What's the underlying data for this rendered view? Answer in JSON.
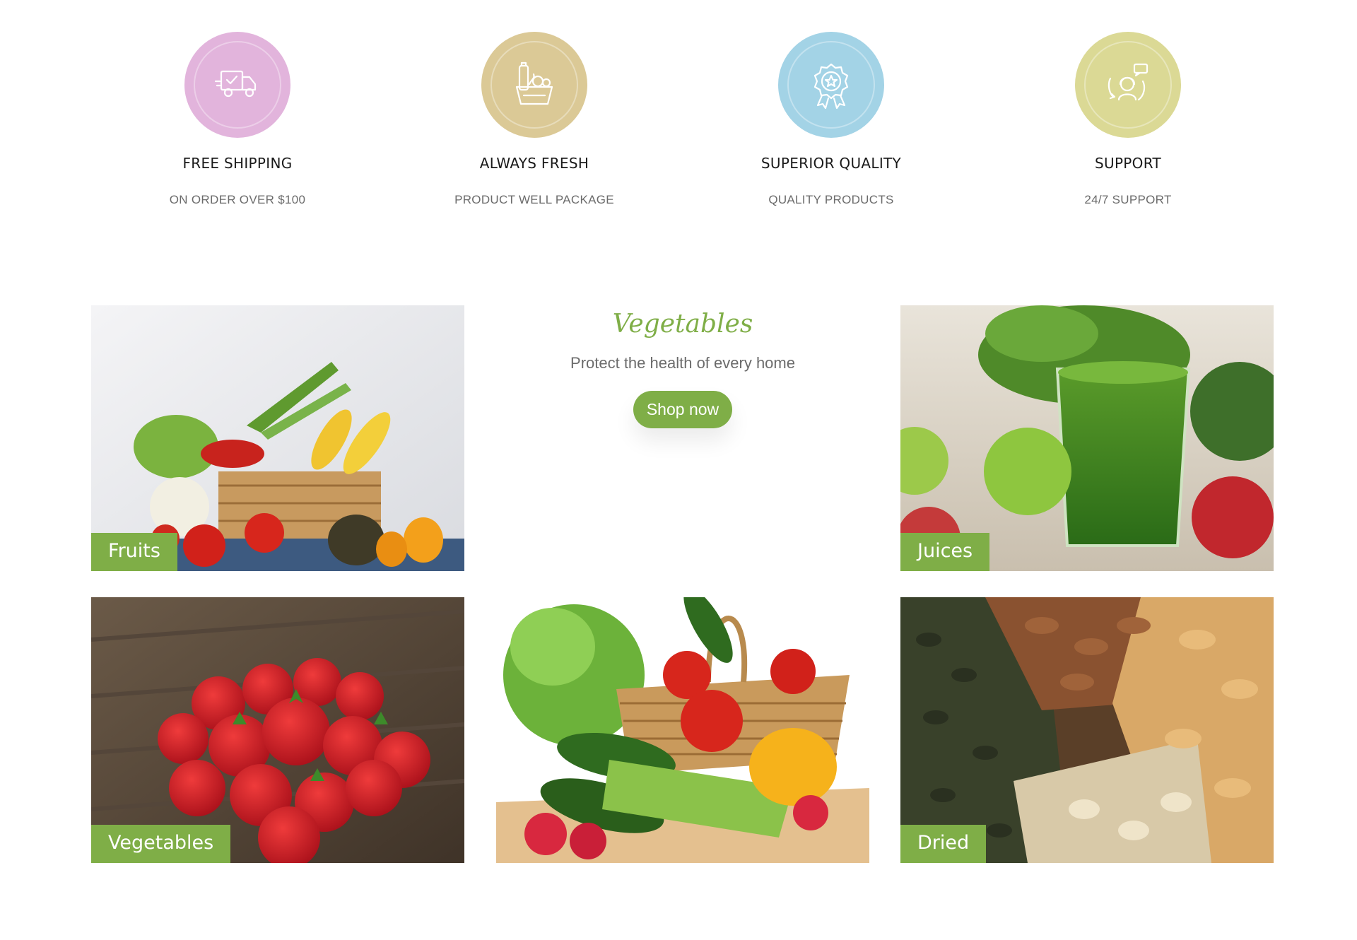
{
  "features": [
    {
      "title": "FREE SHIPPING",
      "subtitle": "ON ORDER OVER $100",
      "icon": "delivery-truck-icon",
      "color": "#e2b4dc"
    },
    {
      "title": "ALWAYS FRESH",
      "subtitle": "PRODUCT WELL PACKAGE",
      "icon": "grocery-bag-icon",
      "color": "#dbc996"
    },
    {
      "title": "SUPERIOR QUALITY",
      "subtitle": "QUALITY PRODUCTS",
      "icon": "quality-badge-icon",
      "color": "#a3d3e6"
    },
    {
      "title": "SUPPORT",
      "subtitle": "24/7 SUPPORT",
      "icon": "customer-support-icon",
      "color": "#dbd995"
    }
  ],
  "promo": {
    "heading": "Vegetables",
    "tagline": "Protect the health of every home",
    "button_label": "Shop now"
  },
  "categories": {
    "fruits": {
      "label": "Fruits",
      "image": "vegetable-basket-photo"
    },
    "juices": {
      "label": "Juices",
      "image": "green-juice-apples-photo"
    },
    "vegetables": {
      "label": "Vegetables",
      "image": "strawberries-photo"
    },
    "basket": {
      "image": "vegetable-wicker-basket-photo"
    },
    "dried": {
      "label": "Dried",
      "image": "mixed-nuts-seeds-photo"
    }
  },
  "colors": {
    "accent": "#7fae47",
    "text_dark": "#1a1a1a",
    "text_muted": "#6b6b6b"
  }
}
